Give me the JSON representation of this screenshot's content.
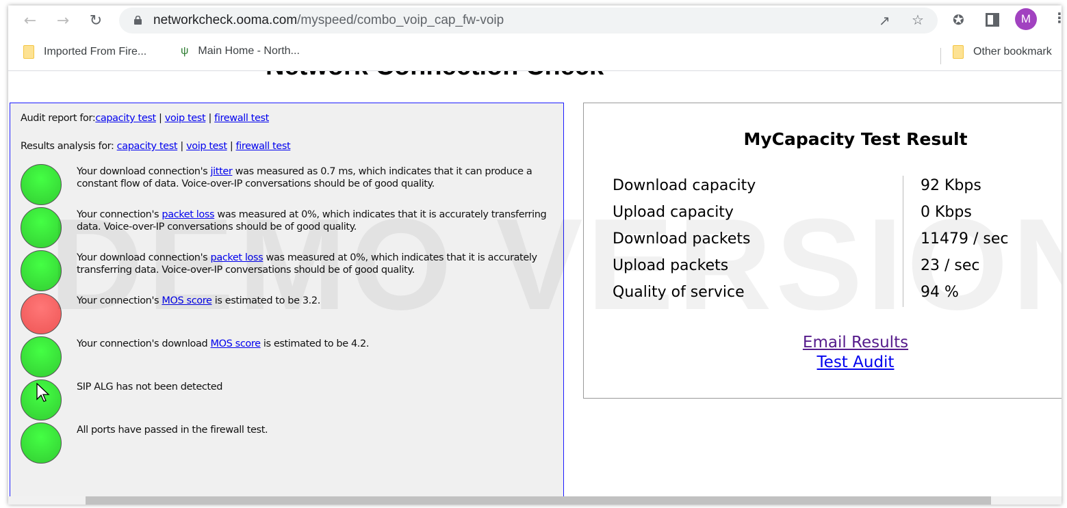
{
  "browser": {
    "url_host": "networkcheck.ooma.com",
    "url_path": "/myspeed/combo_voip_cap_fw-voip",
    "avatar_letter": "M",
    "bookmarks": [
      {
        "label": "Imported From Fire...",
        "icon": "folder-icon"
      },
      {
        "label": "Main Home - North...",
        "icon": "sprout-icon"
      }
    ],
    "other_bookmarks": "Other bookmark"
  },
  "page": {
    "title": "Network Connection Check",
    "watermark": "DEMO VERSION",
    "audit": {
      "prefix": "Audit report for:",
      "links": [
        "capacity test",
        "voip test",
        "firewall test"
      ]
    },
    "analysis": {
      "prefix": "Results analysis for: ",
      "links": [
        "capacity test",
        "voip test",
        "firewall test"
      ]
    },
    "results": [
      {
        "status": "green",
        "pre": "Your download connection's ",
        "link": "jitter",
        "post": " was measured as 0.7 ms, which indicates that it can produce a constant flow of data. Voice-over-IP conversations should be of good quality."
      },
      {
        "status": "green",
        "pre": "Your connection's ",
        "link": "packet loss",
        "post": " was measured at 0%, which indicates that it is accurately transferring data. Voice-over-IP conversations should be of good quality."
      },
      {
        "status": "green",
        "pre": "Your download connection's ",
        "link": "packet loss",
        "post": " was measured at 0%, which indicates that it is accurately transferring data. Voice-over-IP conversations should be of good quality."
      },
      {
        "status": "red",
        "pre": "Your connection's ",
        "link": "MOS score",
        "post": " is estimated to be 3.2."
      },
      {
        "status": "green",
        "pre": "Your connection's download ",
        "link": "MOS score",
        "post": " is estimated to be 4.2."
      },
      {
        "status": "green",
        "pre": "SIP ALG has not been detected",
        "link": "",
        "post": ""
      },
      {
        "status": "green",
        "pre": "All ports have passed in the firewall test.",
        "link": "",
        "post": ""
      }
    ],
    "capacity": {
      "title": "MyCapacity Test Result",
      "rows": [
        {
          "label": "Download capacity",
          "value": "92 Kbps"
        },
        {
          "label": "Upload capacity",
          "value": "0 Kbps"
        },
        {
          "label": "Download packets",
          "value": "11479 / sec"
        },
        {
          "label": "Upload packets",
          "value": "23 / sec"
        },
        {
          "label": "Quality of service",
          "value": "94 %"
        }
      ],
      "email_link": "Email Results",
      "audit_link": "Test Audit"
    }
  },
  "colors": {
    "green": "#3de83d",
    "red": "#f26565",
    "link": "#0000ee",
    "visited": "#551a8b"
  }
}
